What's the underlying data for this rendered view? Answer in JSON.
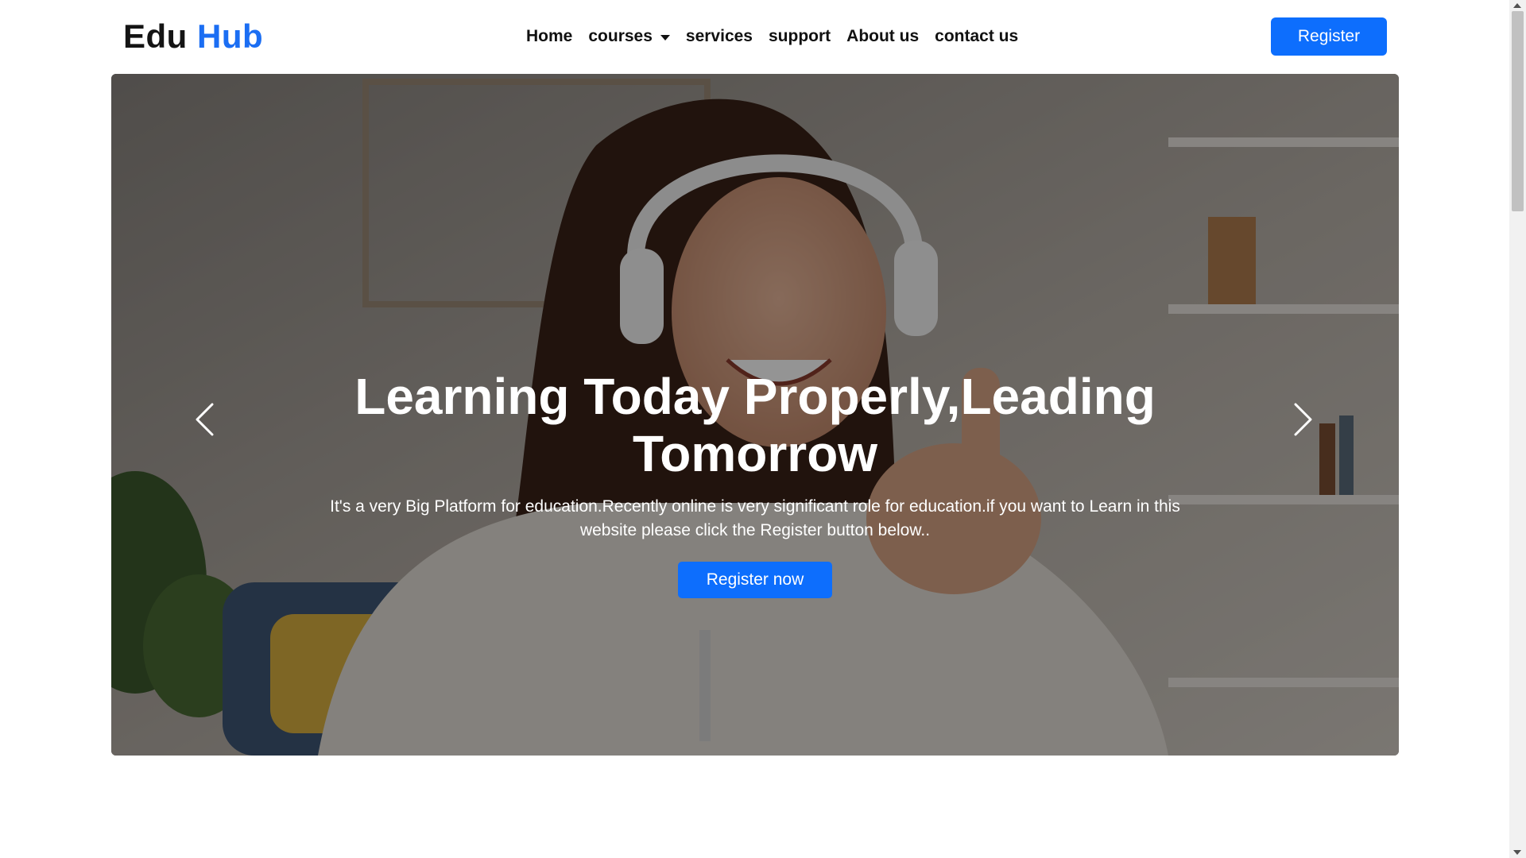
{
  "brand": {
    "part1": "Edu",
    "part2": "Hub"
  },
  "nav": {
    "items": [
      {
        "label": "Home"
      },
      {
        "label": "courses",
        "dropdown": true
      },
      {
        "label": "services"
      },
      {
        "label": "support"
      },
      {
        "label": "About us"
      },
      {
        "label": "contact us"
      }
    ]
  },
  "header": {
    "register_label": "Register"
  },
  "hero": {
    "title": "Learning Today Properly,Leading Tomorrow",
    "text": "It's a very Big Platform for education.Recently online is very significant role for education.if you want to Learn in this website please click the Register button below..",
    "cta_label": "Register now",
    "prev_icon": "chevron-left-icon",
    "next_icon": "chevron-right-icon"
  },
  "colors": {
    "accent": "#0d6efd",
    "brand_blue": "#1b6ef3",
    "text": "#111111"
  }
}
